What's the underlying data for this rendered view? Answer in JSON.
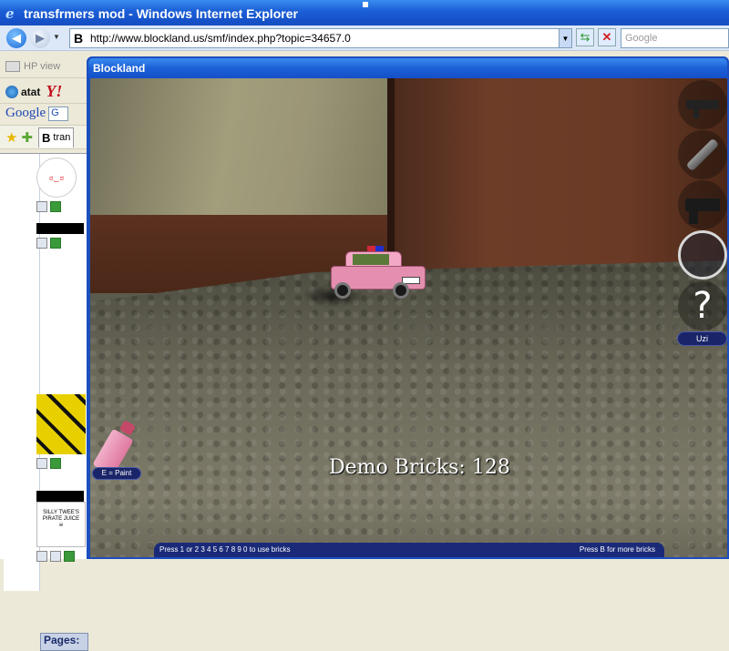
{
  "browser": {
    "title": "transfrmers mod - Windows Internet Explorer",
    "address": "http://www.blockland.us/smf/index.php?topic=34657.0",
    "search_placeholder": "Google",
    "hp_view": "HP view",
    "att_label": "atat",
    "yahoo_label": "Y!",
    "google_label": "Google",
    "google_drop": "G",
    "tab_label": "tran",
    "favicon_letter": "B"
  },
  "forum": {
    "pages_label": "Pages:",
    "pirate_text": "SILLY TWEE'S PIRATE JUICE"
  },
  "game": {
    "window_title": "Blockland",
    "brick_count": "Demo Bricks: 128",
    "selected_tool": "Uzi",
    "paint_hint": "E = Paint",
    "bottom_left": "Press  1  or  2 3 4 5 6 7 8 9 0  to use bricks",
    "bottom_right": "Press  B  for more bricks",
    "help_glyph": "?"
  },
  "icons": [
    "ie-logo-icon",
    "back-icon",
    "forward-icon",
    "refresh-icon",
    "stop-icon",
    "star-icon",
    "add-favorite-icon",
    "assault-rifle-icon",
    "wrench-icon",
    "pistol-icon",
    "spray-can-icon"
  ]
}
